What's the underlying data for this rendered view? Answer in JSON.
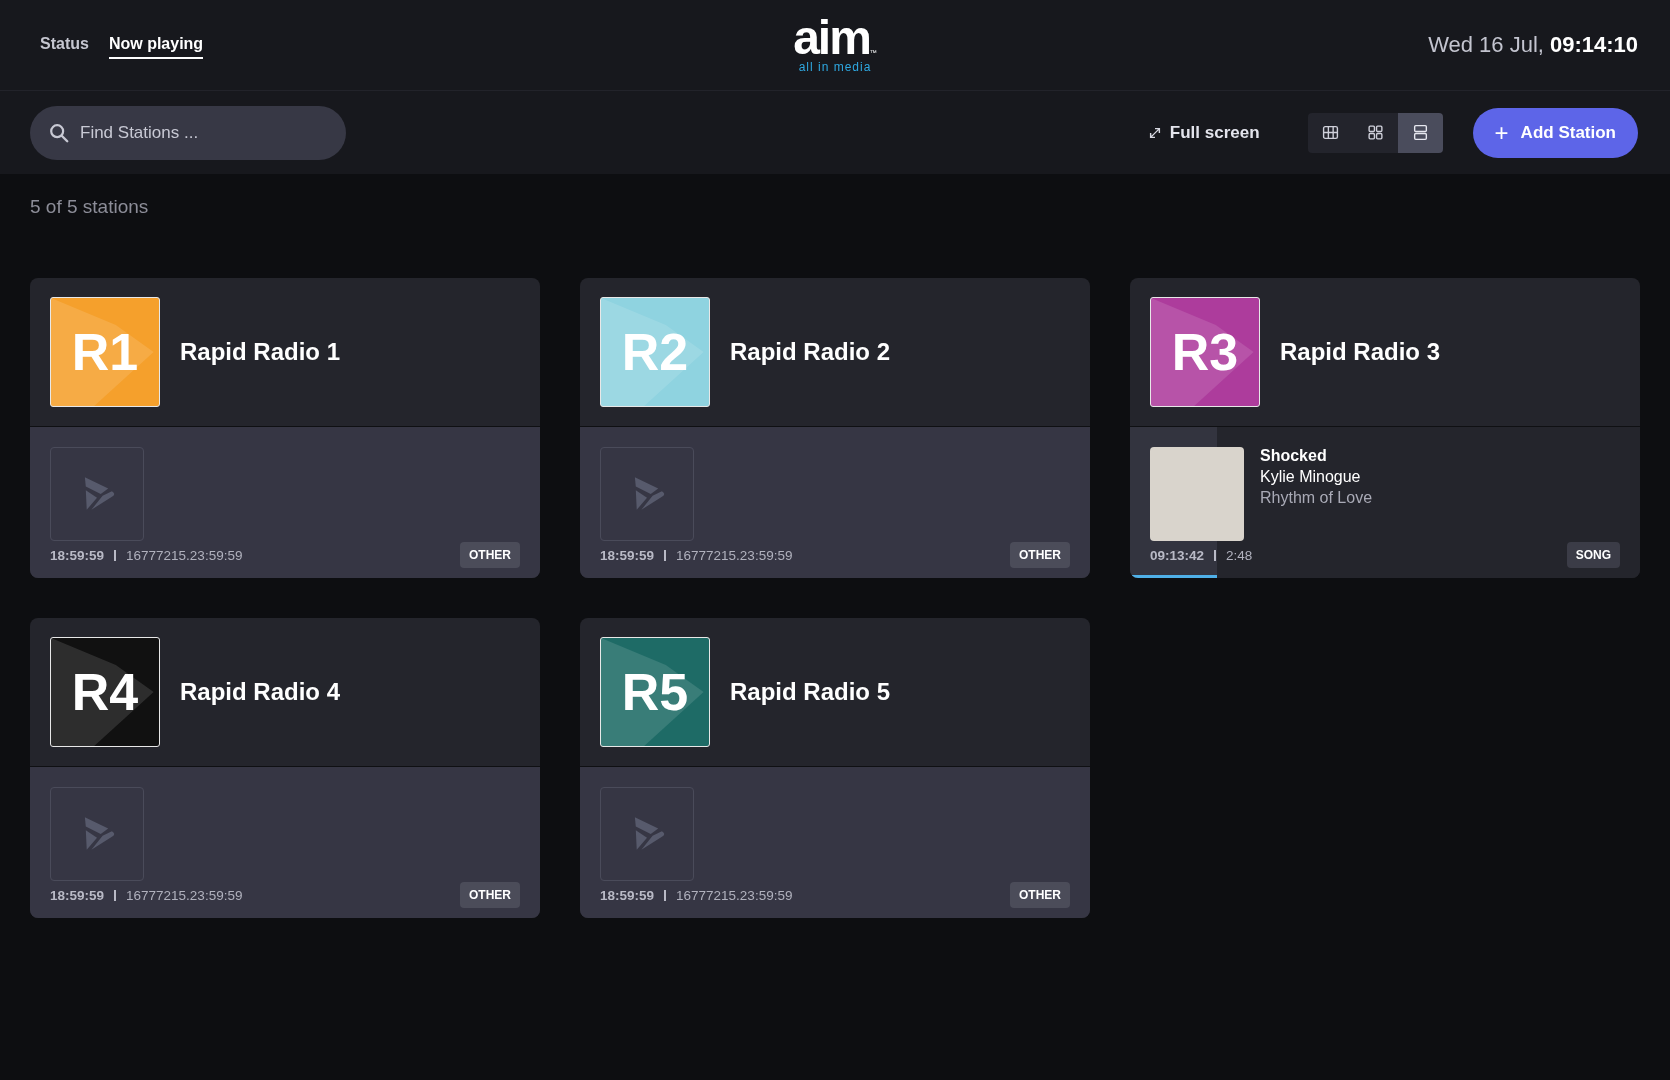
{
  "nav": {
    "tabs": [
      {
        "label": "Status",
        "selected": false
      },
      {
        "label": "Now playing",
        "selected": true
      }
    ]
  },
  "logo": {
    "word": "aim",
    "tagline": "all in media",
    "mark": "™"
  },
  "clock": {
    "date": "Wed 16 Jul,",
    "time": "09:14:10"
  },
  "toolbar": {
    "search": {
      "placeholder": "Find Stations ..."
    },
    "fullscreen": "Full screen",
    "views": [
      {
        "kind": "table",
        "selected": false
      },
      {
        "kind": "grid",
        "selected": false
      },
      {
        "kind": "rows",
        "selected": true
      }
    ],
    "add_button": "Add Station",
    "add_icon": "+"
  },
  "count": "5 of 5 stations",
  "stations": [
    {
      "code": "R1",
      "name": "Rapid Radio 1",
      "color": "#f5a02c",
      "kind": "other",
      "start": "18:59:59",
      "duration": "16777215.23:59:59",
      "tag": "OTHER"
    },
    {
      "code": "R2",
      "name": "Rapid Radio 2",
      "color": "#8fd3e0",
      "kind": "other",
      "start": "18:59:59",
      "duration": "16777215.23:59:59",
      "tag": "OTHER"
    },
    {
      "code": "R3",
      "name": "Rapid Radio 3",
      "color": "#ad3c9c",
      "kind": "song",
      "title": "Shocked",
      "artist": "Kylie Minogue",
      "album": "Rhythm of Love",
      "start": "09:13:42",
      "duration": "2:48",
      "tag": "SONG",
      "level": 0.17
    },
    {
      "code": "R4",
      "name": "Rapid Radio 4",
      "color": "#111111",
      "kind": "other",
      "start": "18:59:59",
      "duration": "16777215.23:59:59",
      "tag": "OTHER"
    },
    {
      "code": "R5",
      "name": "Rapid Radio 5",
      "color": "#1e6b66",
      "kind": "other",
      "start": "18:59:59",
      "duration": "16777215.23:59:59",
      "tag": "OTHER"
    }
  ]
}
